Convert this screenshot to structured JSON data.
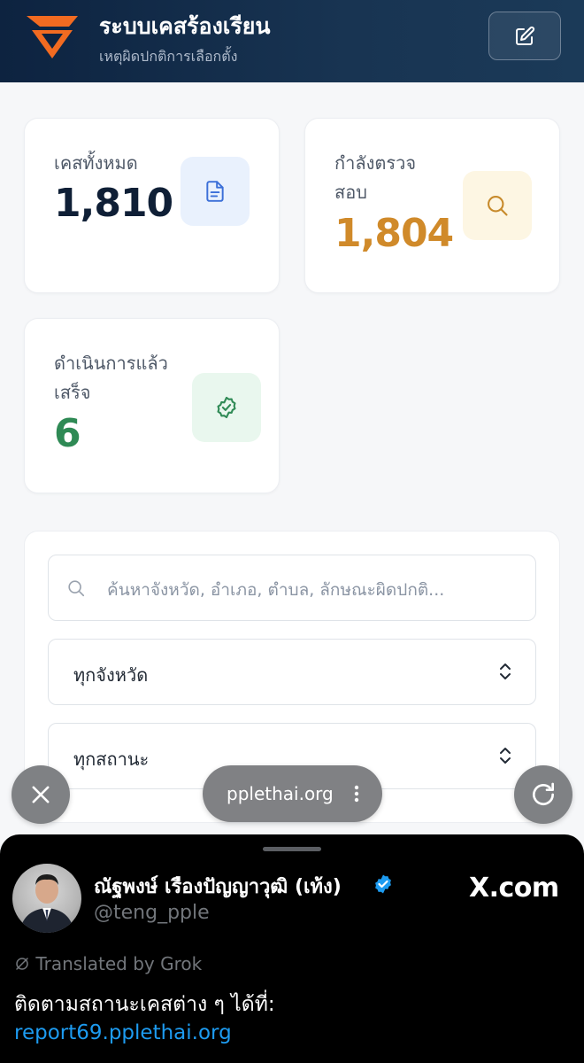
{
  "header": {
    "title": "ระบบเคสร้องเรียน",
    "subtitle": "เหตุผิดปกติการเลือกตั้ง",
    "logo_icon": "v-logo-icon",
    "edit_icon": "edit-icon",
    "colors": {
      "background": "#0d2340",
      "logo": "#f26b21"
    }
  },
  "stats": {
    "total": {
      "label": "เคสทั้งหมด",
      "value": "1,810",
      "icon": "document-icon",
      "color": "#0f1f36",
      "icon_bg": "#e9f1fd"
    },
    "reviewing": {
      "label_line1": "กำลังตรวจ",
      "label_line2": "สอบ",
      "value": "1,804",
      "icon": "search-icon",
      "color": "#d08a2a",
      "icon_bg": "#fdf6e3"
    },
    "completed": {
      "label_line1": "ดำเนินการแล้ว",
      "label_line2": "เสร็จ",
      "value": "6",
      "icon": "check-badge-icon",
      "color": "#2f8a55",
      "icon_bg": "#e9f7ee"
    }
  },
  "filters": {
    "search_placeholder": "ค้นหาจังหวัด, อำเภอ, ตำบล, ลักษณะผิดปกติ...",
    "province_selected": "ทุกจังหวัด",
    "status_selected": "ทุกสถานะ"
  },
  "browser": {
    "url": "pplethai.org",
    "close_icon": "close-icon",
    "reload_icon": "reload-icon",
    "more_icon": "more-vertical-icon"
  },
  "tweet": {
    "author": "ณัฐพงษ์ เรืองปัญญาวุฒิ (เท้ง)",
    "handle": "@teng_pple",
    "source": "X.com",
    "translated": "Translated by Grok",
    "text": "ติดตามสถานะเคสต่าง ๆ ได้ที่:",
    "link": "report69.pplethai.org",
    "colors": {
      "link": "#1d9bf0",
      "verified": "#1d9bf0"
    }
  }
}
